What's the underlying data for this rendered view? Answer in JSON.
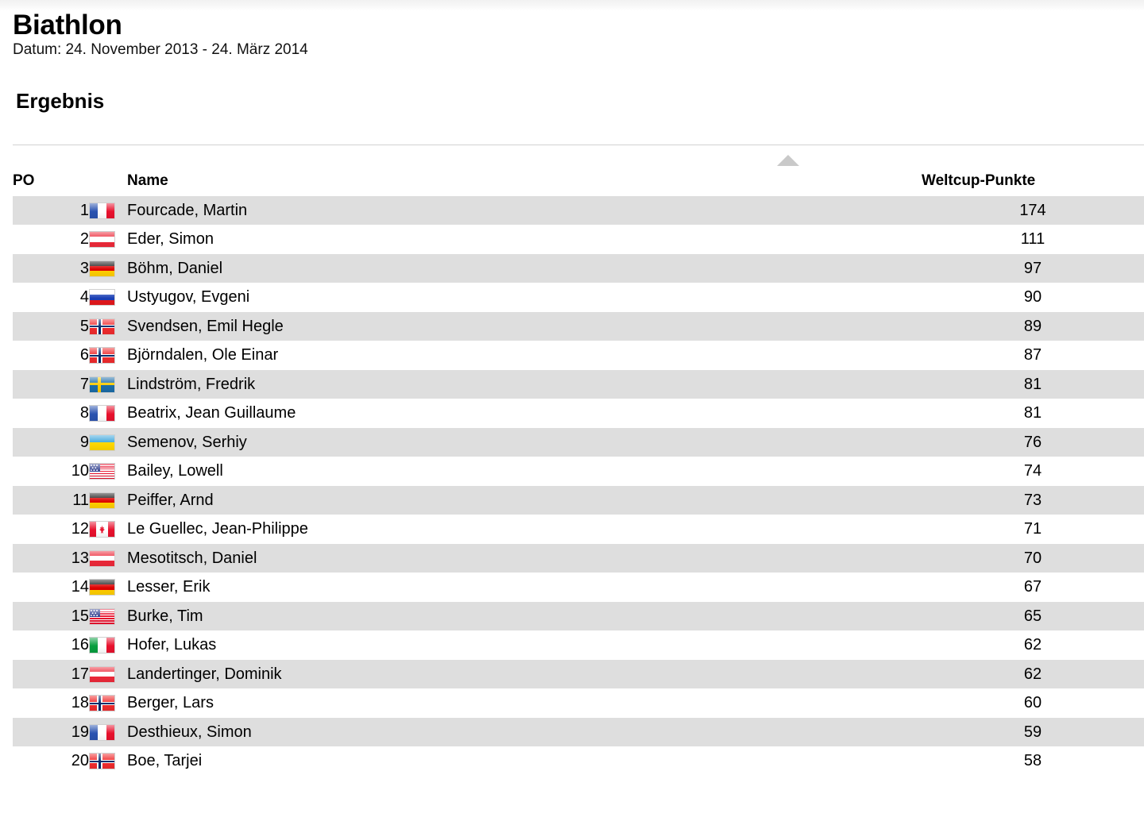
{
  "header": {
    "title": "Biathlon",
    "subtitle": "Datum: 24. November 2013 - 24. März 2014",
    "section_title": "Ergebnis"
  },
  "table": {
    "columns": {
      "rank": "PO",
      "name": "Name",
      "points": "Weltcup-Punkte"
    },
    "sort_indicator": "sort-ascending-triangle",
    "rows": [
      {
        "rank": "1",
        "flag": "fr",
        "flag_name": "flag-france",
        "name": "Fourcade, Martin",
        "points": "174"
      },
      {
        "rank": "2",
        "flag": "at",
        "flag_name": "flag-austria",
        "name": "Eder, Simon",
        "points": "111"
      },
      {
        "rank": "3",
        "flag": "de",
        "flag_name": "flag-germany",
        "name": "Böhm, Daniel",
        "points": "97"
      },
      {
        "rank": "4",
        "flag": "ru",
        "flag_name": "flag-russia",
        "name": "Ustyugov, Evgeni",
        "points": "90"
      },
      {
        "rank": "5",
        "flag": "no",
        "flag_name": "flag-norway",
        "name": "Svendsen, Emil Hegle",
        "points": "89"
      },
      {
        "rank": "6",
        "flag": "no",
        "flag_name": "flag-norway",
        "name": "Björndalen, Ole Einar",
        "points": "87"
      },
      {
        "rank": "7",
        "flag": "se",
        "flag_name": "flag-sweden",
        "name": "Lindström, Fredrik",
        "points": "81"
      },
      {
        "rank": "8",
        "flag": "fr",
        "flag_name": "flag-france",
        "name": "Beatrix, Jean Guillaume",
        "points": "81"
      },
      {
        "rank": "9",
        "flag": "ua",
        "flag_name": "flag-ukraine",
        "name": "Semenov, Serhiy",
        "points": "76"
      },
      {
        "rank": "10",
        "flag": "us",
        "flag_name": "flag-united-states",
        "name": "Bailey, Lowell",
        "points": "74"
      },
      {
        "rank": "11",
        "flag": "de",
        "flag_name": "flag-germany",
        "name": "Peiffer, Arnd",
        "points": "73"
      },
      {
        "rank": "12",
        "flag": "ca",
        "flag_name": "flag-canada",
        "name": "Le Guellec, Jean-Philippe",
        "points": "71"
      },
      {
        "rank": "13",
        "flag": "at",
        "flag_name": "flag-austria",
        "name": "Mesotitsch, Daniel",
        "points": "70"
      },
      {
        "rank": "14",
        "flag": "de",
        "flag_name": "flag-germany",
        "name": "Lesser, Erik",
        "points": "67"
      },
      {
        "rank": "15",
        "flag": "us",
        "flag_name": "flag-united-states",
        "name": "Burke, Tim",
        "points": "65"
      },
      {
        "rank": "16",
        "flag": "it",
        "flag_name": "flag-italy",
        "name": "Hofer, Lukas",
        "points": "62"
      },
      {
        "rank": "17",
        "flag": "at",
        "flag_name": "flag-austria",
        "name": "Landertinger, Dominik",
        "points": "62"
      },
      {
        "rank": "18",
        "flag": "no",
        "flag_name": "flag-norway",
        "name": "Berger, Lars",
        "points": "60"
      },
      {
        "rank": "19",
        "flag": "fr",
        "flag_name": "flag-france",
        "name": "Desthieux, Simon",
        "points": "59"
      },
      {
        "rank": "20",
        "flag": "no",
        "flag_name": "flag-norway",
        "name": "Boe, Tarjei",
        "points": "58"
      }
    ]
  },
  "colors": {
    "row_stripe": "#dedede",
    "row_plain": "#ffffff",
    "divider": "#d2d2d2",
    "sort_triangle": "#c9c9c9"
  }
}
